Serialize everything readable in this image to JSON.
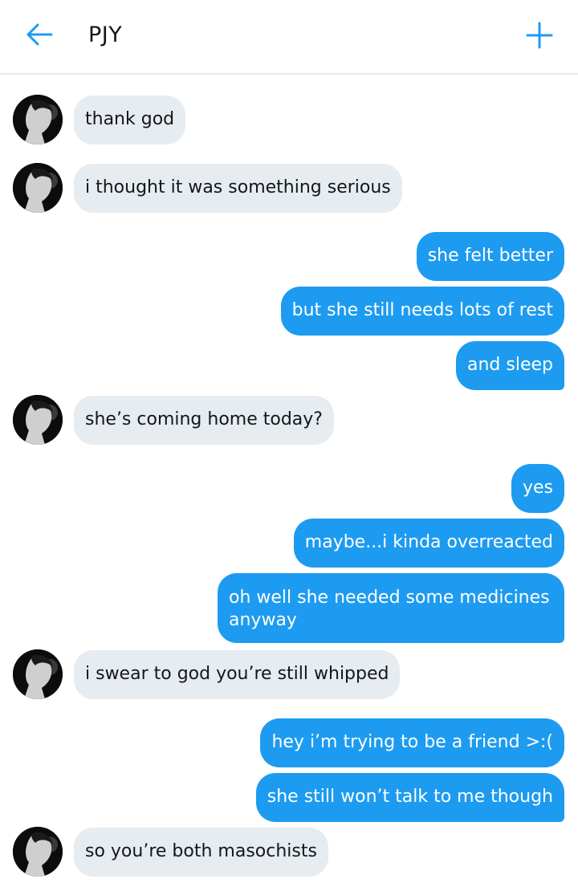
{
  "header": {
    "title": "PJY",
    "back_icon": "arrow-left-icon",
    "add_icon": "plus-icon",
    "accent": "#1d9bf0"
  },
  "colors": {
    "incoming_bubble": "#e6ecf0",
    "outgoing_bubble": "#1d9bf0"
  },
  "messages": [
    {
      "from": "them",
      "text": "thank god"
    },
    {
      "from": "them",
      "text": "i thought it was something serious"
    },
    {
      "from": "me",
      "text": "she felt better"
    },
    {
      "from": "me",
      "text": "but she still needs lots of rest"
    },
    {
      "from": "me",
      "text": "and sleep"
    },
    {
      "from": "them",
      "text": "she’s coming home today?"
    },
    {
      "from": "me",
      "text": "yes"
    },
    {
      "from": "me",
      "text": "maybe...i kinda overreacted"
    },
    {
      "from": "me",
      "text": "oh well she needed some medicines anyway"
    },
    {
      "from": "them",
      "text": "i swear to god you’re still whipped"
    },
    {
      "from": "me",
      "text": "hey i’m trying to be a friend >:("
    },
    {
      "from": "me",
      "text": "she still won’t talk to me though"
    },
    {
      "from": "them",
      "text": "so you’re both masochists"
    }
  ]
}
